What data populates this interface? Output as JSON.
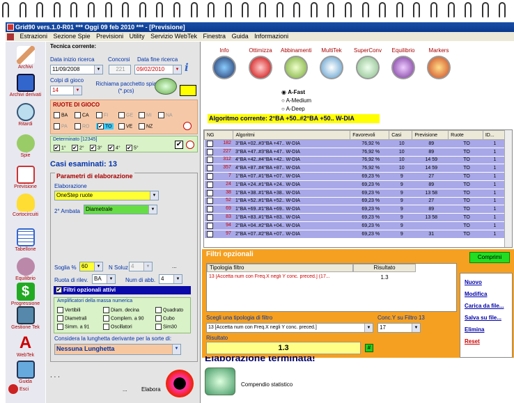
{
  "window": {
    "title": "Grid90 vers.1.0-R01  ***  Oggi 09 feb 2010  ***  - [Previsione]"
  },
  "menu": [
    "Estrazioni",
    "Sezione Spie",
    "Previsioni",
    "Utility",
    "Servizio WebTek",
    "Finestra",
    "Guida",
    "Informazioni"
  ],
  "sidebar": [
    "Archivi",
    "Archivi derivati",
    "Ritardi",
    "Spie",
    "Previsione",
    "Cortocircuiti",
    "Tabellone",
    "Equilibrio",
    "Progressione",
    "Gestione Tek",
    "WebTek",
    "Guida",
    "Esci"
  ],
  "left": {
    "tecnica": "Tecnica corrente:",
    "data_inizio_lbl": "Data inizio ricerca",
    "data_inizio": "11/09/2008",
    "concorsi_lbl": "Concorsi",
    "concorsi": "221",
    "data_fine_lbl": "Data fine ricerca",
    "data_fine": "09/02/2010",
    "colpi_lbl": "Colpi di gioco",
    "colpi": "14",
    "richiama": "Richiama pacchetto spia (*.pcs)",
    "ruote_title": "RUOTE DI GIOCO",
    "ruote": [
      "BA",
      "CA",
      "FI",
      "GE",
      "MI",
      "NA",
      "PA",
      "RO",
      "TO",
      "VE",
      "NZ"
    ],
    "determinato": "Determinato [12345]",
    "det_items": [
      "1°",
      "2°",
      "3°",
      "4°",
      "5°"
    ],
    "casi": "Casi esaminati: 13",
    "params_title": "Parametri di elaborazione",
    "elaborazione_lbl": "Elaborazione",
    "elaborazione": "OneStep ruote",
    "ambata_lbl": "2° Ambata",
    "ambata": "Diametrale",
    "soglia_lbl": "Soglia %",
    "soglia": "60",
    "nsoluz_lbl": "N Soluz",
    "nsoluz": "4",
    "ellipsis": "...",
    "ruota_rilev_lbl": "Ruota di rilev.",
    "ruota_rilev": "BA",
    "num_abb_lbl": "Num di abb.",
    "num_abb": "4",
    "filtri_attivi": "Filtri opzionali attivi",
    "ampl_title": "Amplificatori della massa numerica",
    "ampl": [
      "Vertibili",
      "Diam. decina",
      "Quadrato",
      "Diametrali",
      "Complem. a 90",
      "Cubo",
      "Simm. a 91",
      "Oscillatori",
      "Sim30"
    ],
    "lunghetta_lbl": "Considera la lunghetta derivante per la sorte di:",
    "lunghetta": "Nessuna Lunghetta",
    "dots": ". . .",
    "dots2": "...",
    "elabora": "Elabora"
  },
  "toolbar": [
    "Info",
    "Ottimizza",
    "Abbinamenti",
    "MultiTek",
    "SuperConv",
    "Equilibrio",
    "Markers"
  ],
  "modes": [
    "A-Fast",
    "A-Medium",
    "A-Deep"
  ],
  "algoritmo": "Algoritmo corrente: 2°BA +50..#2°BA +50.. W-DIA",
  "grid": {
    "headers": [
      "NG",
      "Algoritmi",
      "Favorevoli",
      "Casi",
      "Previsione",
      "Ruote",
      "ID..."
    ],
    "rows": [
      [
        "182",
        "3°BA +02..#3°BA +47.. W-DIA",
        "76,92 %",
        "10",
        "89",
        "TO",
        "1"
      ],
      [
        "227",
        "3°BA +47..#3°BA +47.. W-DIA",
        "76,92 %",
        "10",
        "89",
        "TO",
        "1"
      ],
      [
        "312",
        "4°BA +42..#4°BA +42.. W-DIA",
        "76,92 %",
        "10",
        "14 59",
        "TO",
        "1"
      ],
      [
        "357",
        "4°BA +87..#4°BA +87.. W-DIA",
        "76,92 %",
        "10",
        "14 59",
        "TO",
        "1"
      ],
      [
        "7",
        "1°BA +07..#1°BA +07.. W-DIA",
        "69,23 %",
        "9",
        "27",
        "TO",
        "1"
      ],
      [
        "24",
        "1°BA +24..#1°BA +24.. W-DIA",
        "69,23 %",
        "9",
        "89",
        "TO",
        "1"
      ],
      [
        "38",
        "1°BA +38..#1°BA +38.. W-DIA",
        "69,23 %",
        "9",
        "13 58",
        "TO",
        "1"
      ],
      [
        "52",
        "1°BA +52..#1°BA +52.. W-DIA",
        "69,23 %",
        "9",
        "27",
        "TO",
        "1"
      ],
      [
        "69",
        "1°BA +69..#1°BA +69.. W-DIA",
        "69,23 %",
        "9",
        "89",
        "TO",
        "1"
      ],
      [
        "83",
        "1°BA +83..#1°BA +83.. W-DIA",
        "69,23 %",
        "9",
        "13 58",
        "TO",
        "1"
      ],
      [
        "94",
        "2°BA +04..#2°BA +04.. W-DIA",
        "69,23 %",
        "9",
        "",
        "TO",
        "1"
      ],
      [
        "97",
        "2°BA +07..#2°BA +07.. W-DIA",
        "69,23 %",
        "9",
        "31",
        "TO",
        "1"
      ]
    ]
  },
  "filtri": {
    "title": "Filtri opzionali",
    "comprimi": "Comprimi",
    "headers": [
      "Tipologia filtro",
      "Risultato"
    ],
    "row": [
      "13 [Accetta num con Freq.X negli Y conc. preced.] (17...",
      "1.3"
    ],
    "scegli_lbl": "Scegli una tipologia di filtro",
    "scegli": "13 [Accetta num con Freq.X negli Y conc. preced.]",
    "conc_lbl": "Conc.Y su Filtro 13",
    "conc": "17",
    "risultato_lbl": "Risultato",
    "risultato": "1.3",
    "hash": "#",
    "links": [
      "Nuovo",
      "Modifica",
      "Carica da file...",
      "Salva su file...",
      "Elimina",
      "Reset"
    ]
  },
  "status": "Elaborazione terminata!",
  "compendio": "Compendio statistico"
}
